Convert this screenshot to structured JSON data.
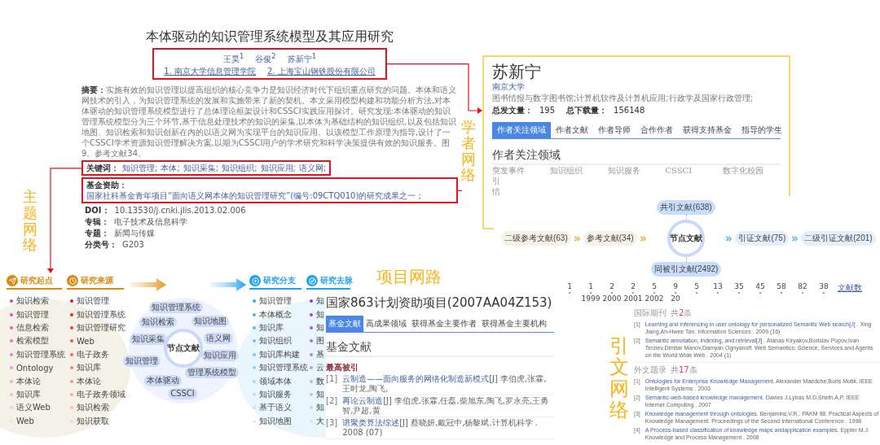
{
  "paper": {
    "title": "本体驱动的知识管理系统模型及其应用研究",
    "authors": [
      "王昊$^{1}$",
      "谷俊$^{2}$",
      "苏新宁$^{1}$"
    ],
    "affiliations": [
      "1. 南京大学信息管理学院",
      "2. 上海宝山钢铁股份有限公司"
    ],
    "abstract": {
      "label": "摘要：",
      "text": "实施有效的知识管理以提高组织的核心竞争力是知识经济时代下组织重点研究的问题。本体和语义网技术的引入，为知识管理系统的发展和实施带来了新的契机。本文采用模型构建和功能分析方法,对本体驱动的知识管理系统模型进行了总体理论框架设计和CSSCI实践应用探讨。研究发现:本体驱动的知识管理系统模型分为三个环节,基于信息处理技术的知识的采集,以本体为基础结构的知识组织,以及包括知识地图、知识检索和知识创新在内的以语义网为实现平台的知识应用。以该模型工作原理为指导,设计了一个CSSCI学术资源知识管理解决方案,以期为CSSCI用户的学术研究和科学决策提供有效的知识服务。图9。参考文献34。"
    },
    "keywords": {
      "label": "关键词：",
      "items": [
        "知识管理;",
        "本体;",
        "知识采集;",
        "知识组织;",
        "知识应用;",
        "语义网;"
      ]
    },
    "fund": {
      "label": "基金资助：",
      "text": "国家社科基金青年项目“面向语义网本体的知识管理研究”(编号:09CTQ010)的研究成果之一；"
    },
    "meta": [
      {
        "label": "DOI：",
        "value": "10.13530/j.cnki.jlis.2013.02.006"
      },
      {
        "label": "专辑：",
        "value": "电子技术及信息科学"
      },
      {
        "label": "专题：",
        "value": "新闻与传媒"
      },
      {
        "label": "分类号：",
        "value": "G203"
      }
    ]
  },
  "labels": {
    "scholar": "学者网络",
    "topic": "主题网络",
    "project": "项目网路",
    "citation": "引文网络"
  },
  "author": {
    "name": "苏新宁",
    "org": "南京大学",
    "fields": "图书情报与数字图书馆;计算机软件及计算机应用;行政学及国家行政管理;",
    "stats": [
      {
        "label": "总发文量：",
        "value": "195"
      },
      {
        "label": "总下载量：",
        "value": "156148"
      }
    ],
    "tabs": [
      {
        "label": "作者关注领域",
        "selected": true
      },
      {
        "label": "作者文献",
        "selected": false
      },
      {
        "label": "作者导师",
        "selected": false
      },
      {
        "label": "合作作者",
        "selected": false
      },
      {
        "label": "获得支持基金",
        "selected": false
      },
      {
        "label": "指导的学生",
        "selected": false
      }
    ],
    "section": "作者关注领域",
    "field_rows": [
      [
        "突发事件",
        "知识组织",
        "知识服务",
        "CSSCI",
        "数字化校园"
      ],
      [
        "引"
      ],
      [
        "情"
      ]
    ]
  },
  "network": {
    "center": "节点文献",
    "above": "共引文献(638)",
    "below": "同被引文献(2492)",
    "left": [
      {
        "label": "二级参考文献(63)",
        "kind": "reference"
      },
      {
        "label": "参考文献(34)",
        "kind": "reference"
      }
    ],
    "right": [
      {
        "label": "引证文献(75)",
        "kind": "citing"
      },
      {
        "label": "二级引证文献(201)",
        "kind": "citing"
      }
    ]
  },
  "timeline": {
    "legend": "文献数",
    "items": [
      {
        "count": "1"
      },
      {
        "count": "1",
        "year": "1999"
      },
      {
        "count": "2",
        "year": "2000"
      },
      {
        "count": "2",
        "year": "2001"
      },
      {
        "count": "5",
        "year": "2002"
      },
      {
        "count": "9",
        "year": "20"
      },
      {
        "count": "5"
      },
      {
        "count": "13"
      },
      {
        "count": "35"
      },
      {
        "count": "45"
      },
      {
        "count": "58"
      },
      {
        "count": "82"
      },
      {
        "count": "38"
      }
    ]
  },
  "topic": {
    "center": "节点文献",
    "tags": [
      "知识管理系统",
      "知识检索",
      "知识地图",
      "知识采集",
      "语义网",
      "知识应用",
      "知识管理",
      "管理系统模型",
      "本体驱动",
      "CSSCI"
    ],
    "columns": [
      {
        "kind": "origin",
        "title": "研究起点",
        "color": "#e23cb4",
        "items": [
          "知识检索",
          "知识管理",
          "信息检索",
          "检索模型",
          "知识管理系统",
          "Ontology",
          "本体论",
          "知识库",
          "语义Web",
          "Web"
        ]
      },
      {
        "kind": "origin",
        "title": "研究来源",
        "color": "#ee1111",
        "items": [
          "知识管理",
          "知识管理系统",
          "知识管理研究",
          "Web",
          "电子政务",
          "知识库",
          "本体论",
          "电子政务领域",
          "知识检索",
          "知识获取"
        ]
      },
      {
        "kind": "branch",
        "title": "研究分支",
        "color": "#2ab0ee",
        "items": [
          "知识管理",
          "本体概念",
          "知识库",
          "知识组织",
          "知识库构建",
          "知识管理系统",
          "领域本体",
          "知识服务",
          "基于语义",
          "知识地图"
        ]
      },
      {
        "kind": "branch",
        "title": "研究去脉",
        "color": "#7a3ee6",
        "items": [
          "知",
          "知",
          "知",
          "图",
          "基",
          "云",
          "数",
          "知",
          "知",
          "大"
        ]
      }
    ]
  },
  "project": {
    "title": "国家863计划资助项目(2007AA04Z153)",
    "tabs": [
      {
        "label": "基金文献",
        "selected": true
      },
      {
        "label": "高成果领域",
        "selected": false
      },
      {
        "label": "获得基金主要作者",
        "selected": false
      },
      {
        "label": "获得基金主要机构",
        "selected": false
      }
    ],
    "section": "基金文献",
    "subsection": "最高被引",
    "items": [
      {
        "num": "[1]",
        "title": "云制造——面向服务的网络化制造新模式",
        "rest": "[J] 李伯虎,张霖,王时龙,陶飞,"
      },
      {
        "num": "[2]",
        "title": "再论云制造",
        "rest": "[J] 李伯虎,张霖,任磊,柴旭东,陶飞,罗永亮,王勇智,尹超,黄"
      },
      {
        "num": "[3]",
        "title": "谱聚类算法综述",
        "rest": "[J] 蔡晓妍,戴冠中,杨黎斌.计算机科学 . 2008 (07)"
      }
    ]
  },
  "citations": [
    {
      "title": "国际期刊",
      "count_prefix": "共",
      "count": "2",
      "count_suffix": "条",
      "entries": [
        {
          "num": "[1]",
          "title": "Learning and inferencing in user ontology for personalized Semantic Web search[J]",
          "rest": " . Xing Jiang,Ah-Hwee Tan.  Information Sciences . 2009 (16)"
        },
        {
          "num": "[2]",
          "title": "Semantic annotation, indexing, and retrieval[J]",
          "rest": " . Atanas Kiryakov,Borislav Popov,Ivan Terziev,Dimitar Manov,Damyan Ognyanoff.  Web Semantics: Science, Services and Agents on the World Wide Web . 2004 (1)"
        }
      ]
    },
    {
      "title": "外文题录",
      "count_prefix": "共",
      "count": "17",
      "count_suffix": "条",
      "entries": [
        {
          "num": "[1]",
          "title": "Ontologies for Enterprise Knowledge Management.",
          "rest": " Alexander Maedche,Boris Motik. IEEE Intelligent Systems . 2003"
        },
        {
          "num": "[2]",
          "title": "Semantic-web-based knowledge management.",
          "rest": " Davies J,Lytras M.D,Sheth,A.P. IEEE Internet Computing . 2007"
        },
        {
          "num": "[3]",
          "title": "Knowledge management through ontologies.",
          "rest": " Benjamins,V.R.. PAKM 98. Practical Aspects of Knowledge Management. Proceedings of the Second International Conference . 1998"
        },
        {
          "num": "[4]",
          "title": "A Process-based classification of knowledge maps andapplication examples.",
          "rest": " Eppler M.J. Knowledge and Process Management . 2008"
        }
      ]
    }
  ]
}
